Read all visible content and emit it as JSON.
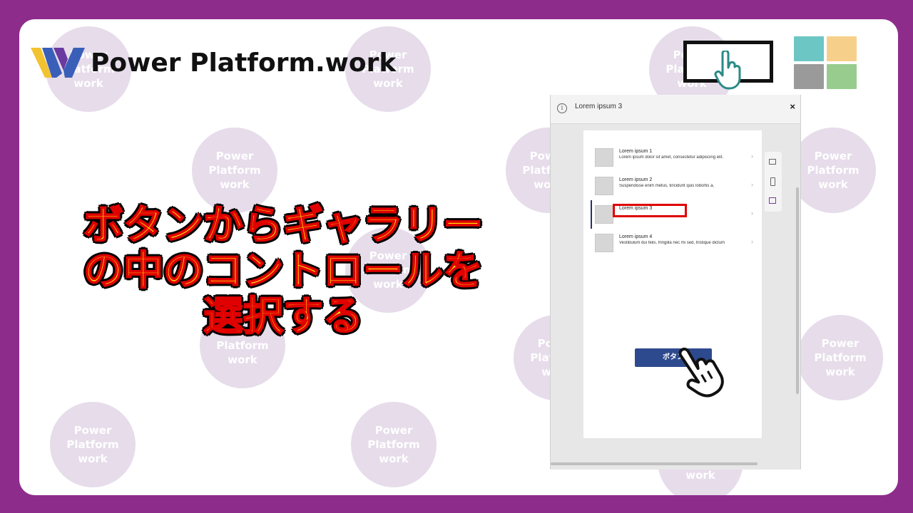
{
  "brand": {
    "name": "Power Platform.work",
    "colors": {
      "background": "#8e2c8c",
      "logo_yellow": "#f2c230",
      "logo_blue": "#3a5fb8",
      "logo_purple": "#6a3aa0"
    }
  },
  "watermark": {
    "text": "Power\nPlatform\nwork"
  },
  "headline": {
    "lines": [
      "ボタンからギャラリー",
      "の中のコントロールを",
      "選択する"
    ],
    "colors": {
      "fill": "#ffee00",
      "stroke": "#e00000",
      "outline": "#000000"
    }
  },
  "icons": {
    "button_icon": "hand-pointer-on-button-icon",
    "gallery_icon": "gallery-tiles-icon",
    "tile_colors": [
      "#6cc6c4",
      "#f6d08a",
      "#9a9a9a",
      "#98cc8e"
    ]
  },
  "panel": {
    "title": "Lorem ipsum 3",
    "close": "×",
    "info": "i",
    "gallery": [
      {
        "title": "Lorem ipsum 1",
        "subtitle": "Lorem ipsum dolor sit amet, consectetur adipiscing elit."
      },
      {
        "title": "Lorem ipsum 2",
        "subtitle": "Suspendisse enim metus, tincidunt quis lobortis a,"
      },
      {
        "title": "Lorem ipsum 3",
        "subtitle": ""
      },
      {
        "title": "Lorem ipsum 4",
        "subtitle": "Vestibulum dui felis, fringilla nec mi sed, tristique dictum"
      }
    ],
    "chevron": "›",
    "button_label": "ボタン",
    "highlight_color": "#e00000",
    "button_color": "#2e4a8e"
  }
}
